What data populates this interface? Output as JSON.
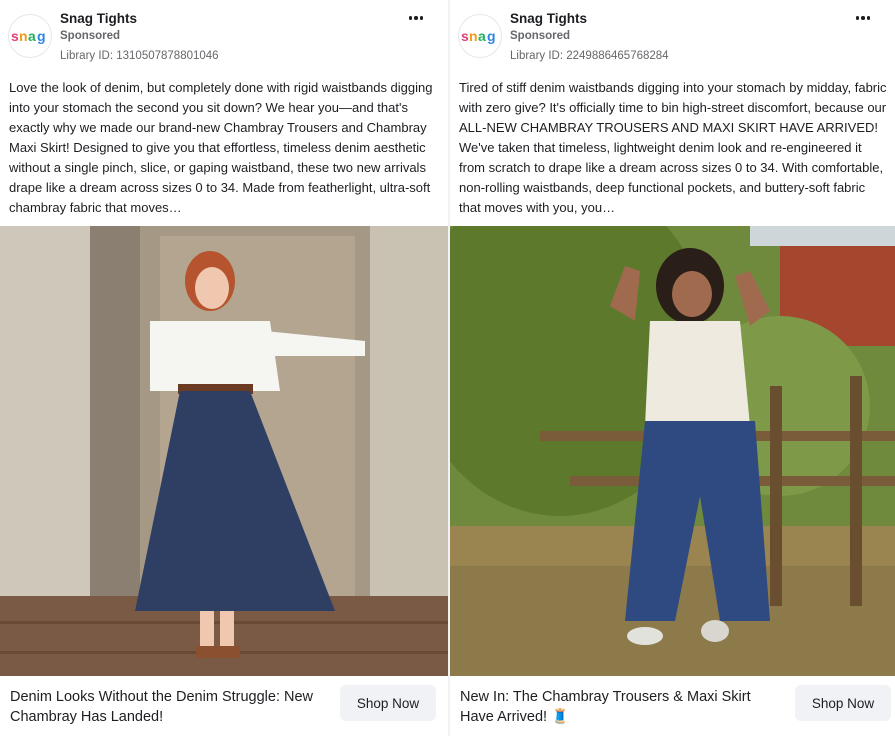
{
  "ads": [
    {
      "advertiser": "Snag Tights",
      "logo_text": "snag",
      "sponsored": "Sponsored",
      "library_id": "Library ID: 1310507878801046",
      "body": "Love the look of denim, but completely done with rigid waistbands digging into your stomach the second you sit down? We hear you—and that's exactly why we made our brand-new Chambray Trousers and Chambray Maxi Skirt! Designed to give you that effortless, timeless denim aesthetic without a single pinch, slice, or gaping waistband, these two new arrivals drape like a dream across sizes 0 to 34. Made from featherlight, ultra-soft chambray fabric that moves…",
      "headline": "Denim Looks Without the Denim Struggle: New Chambray Has Landed!",
      "cta": "Shop Now"
    },
    {
      "advertiser": "Snag Tights",
      "logo_text": "snag",
      "sponsored": "Sponsored",
      "library_id": "Library ID: 2249886465768284",
      "body": "Tired of stiff denim waistbands digging into your stomach by midday, fabric with zero give? It's officially time to bin high-street discomfort, because our ALL-NEW CHAMBRAY TROUSERS AND MAXI SKIRT HAVE ARRIVED! We've taken that timeless, lightweight denim look and re-engineered it from scratch to drape like a dream across sizes 0 to 34. With comfortable, non-rolling waistbands, deep functional pockets, and buttery-soft fabric that moves with you, you…",
      "headline": "New In: The Chambray Trousers & Maxi Skirt Have Arrived! 🧵",
      "cta": "Shop Now"
    }
  ],
  "colors": {
    "logo_s": "#e0407a",
    "logo_n": "#f39c12",
    "logo_a": "#27ae60",
    "logo_g": "#2e86de",
    "cta_bg": "#f0f2f5",
    "muted_text": "#65676b"
  }
}
